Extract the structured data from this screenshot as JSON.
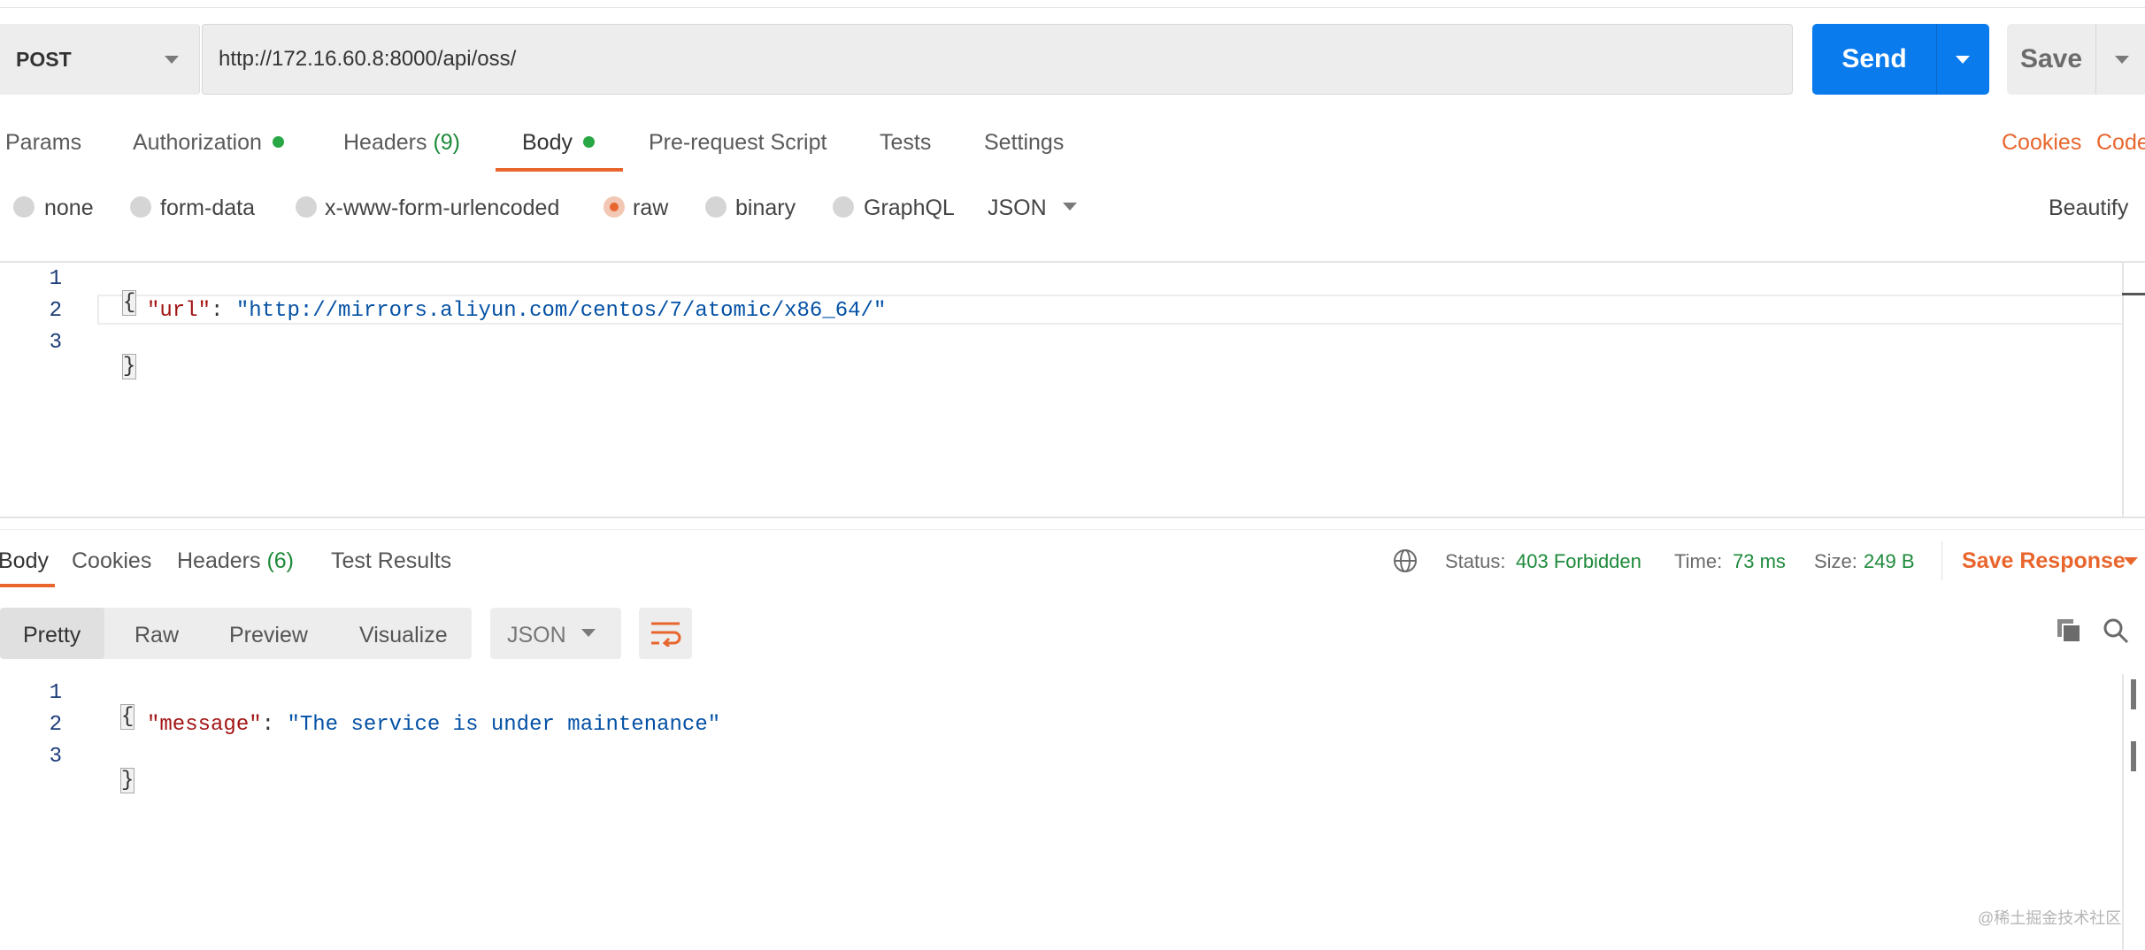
{
  "request": {
    "method": "POST",
    "url": "http://172.16.60.8:8000/api/oss/",
    "send_label": "Send",
    "save_label": "Save"
  },
  "request_tabs": [
    {
      "label": "Params"
    },
    {
      "label": "Authorization"
    },
    {
      "label": "Headers",
      "count": "(9)"
    },
    {
      "label": "Body"
    },
    {
      "label": "Pre-request Script"
    },
    {
      "label": "Tests"
    },
    {
      "label": "Settings"
    }
  ],
  "request_links": {
    "cookies": "Cookies",
    "code": "Code"
  },
  "body_types": [
    {
      "label": "none",
      "selected": false
    },
    {
      "label": "form-data",
      "selected": false
    },
    {
      "label": "x-www-form-urlencoded",
      "selected": false
    },
    {
      "label": "raw",
      "selected": true
    },
    {
      "label": "binary",
      "selected": false
    },
    {
      "label": "GraphQL",
      "selected": false
    }
  ],
  "raw_format": "JSON",
  "beautify_label": "Beautify",
  "request_body": {
    "line_numbers": [
      "1",
      "2",
      "3"
    ],
    "open": "{",
    "key": "\"url\"",
    "colon": ": ",
    "value": "\"http://mirrors.aliyun.com/centos/7/atomic/x86_64/\"",
    "close": "}"
  },
  "response_tabs": [
    {
      "label": "Body"
    },
    {
      "label": "Cookies"
    },
    {
      "label": "Headers",
      "count": "(6)"
    },
    {
      "label": "Test Results"
    }
  ],
  "response_status": {
    "status_label": "Status:",
    "status_value": "403 Forbidden",
    "time_label": "Time:",
    "time_value": "73 ms",
    "size_label": "Size:",
    "size_value": "249 B",
    "save_response": "Save Response"
  },
  "response_views": [
    "Pretty",
    "Raw",
    "Preview",
    "Visualize"
  ],
  "response_format": "JSON",
  "response_body": {
    "line_numbers": [
      "1",
      "2",
      "3"
    ],
    "open": "{",
    "key": "\"message\"",
    "colon": ": ",
    "value": "\"The service is under maintenance\"",
    "close": "}"
  },
  "watermark": "@稀土掘金技术社区",
  "colors": {
    "accent": "#e8662d",
    "send": "#097bed",
    "status_ok": "#28a745"
  }
}
